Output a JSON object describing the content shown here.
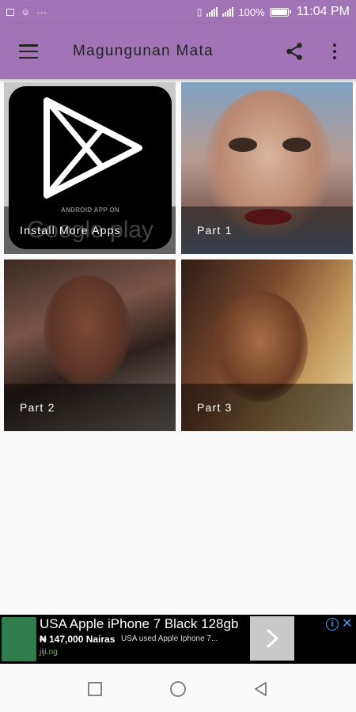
{
  "status_bar": {
    "left_icons": [
      "image-icon",
      "user-icon",
      "ellipsis-icon"
    ],
    "battery": "100%",
    "time": "11:04 PM"
  },
  "app_bar": {
    "title": "Magungunan  Mata",
    "icons": [
      "menu-icon",
      "share-icon",
      "more-vert-icon"
    ]
  },
  "grid": {
    "items": [
      {
        "label": "Install  More  Apps",
        "logo_caption": "ANDROID APP ON",
        "logo_text": "Google play"
      },
      {
        "label": "Part  1"
      },
      {
        "label": "Part  2"
      },
      {
        "label": "Part  3"
      }
    ]
  },
  "ad": {
    "title": "USA Apple iPhone 7 Black 128gb",
    "price": "₦ 147,000 Nairas",
    "subtitle": "USA used Apple Iphone 7...",
    "domain": "jiji.ng"
  },
  "nav_bar": {
    "icons": [
      "recents-square-icon",
      "home-circle-icon",
      "back-triangle-icon"
    ]
  },
  "colors": {
    "app_bar": "#a274b5",
    "background": "#fafafa",
    "ad_background": "#000000"
  }
}
